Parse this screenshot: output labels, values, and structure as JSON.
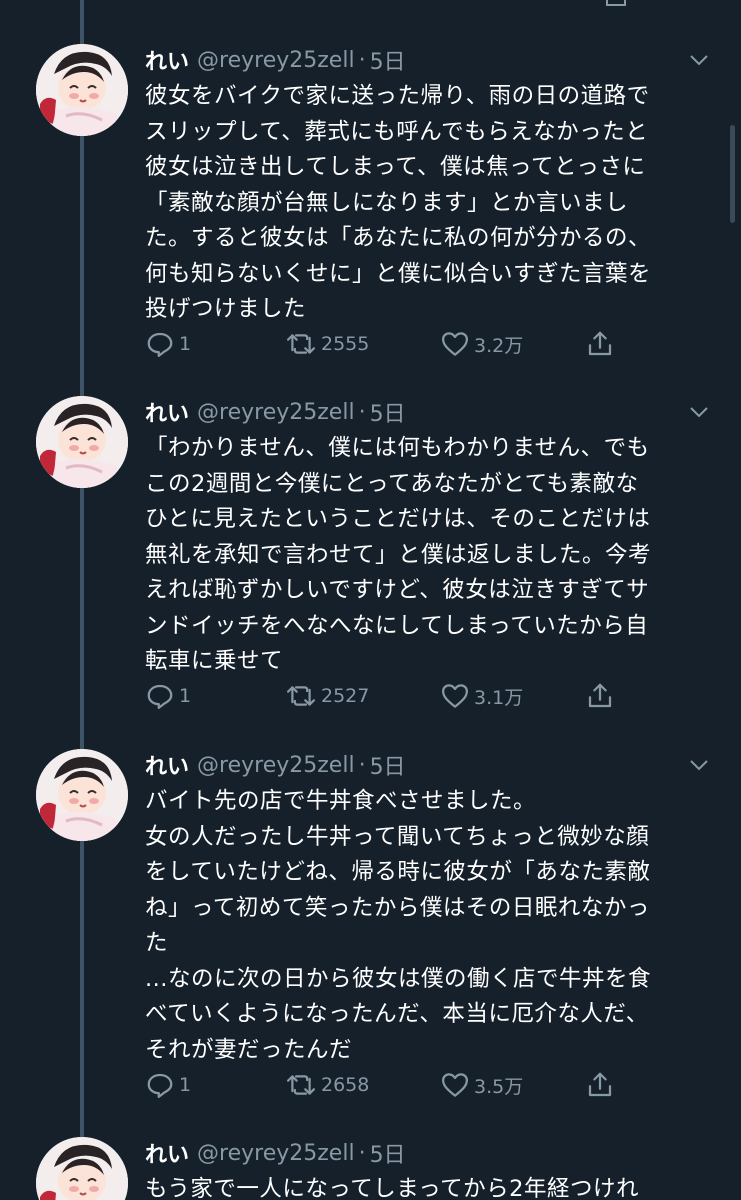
{
  "colors": {
    "background": "#15202b",
    "secondary_text": "#8899a6",
    "thread_line": "#3d5466"
  },
  "tweets": [
    {
      "name": "れい",
      "handle": "@reyrey25zell",
      "dot": "·",
      "age": "5日",
      "lines": [
        "彼女をバイクで家に送った帰り、雨の日の道路で",
        "スリップして、葬式にも呼んでもらえなかったと",
        "彼女は泣き出してしまって、僕は焦ってとっさに",
        "「素敵な顔が台無しになります」とか言いまし",
        "た。すると彼女は「あなたに私の何が分かるの、",
        "何も知らないくせに」と僕に似合いすぎた言葉を",
        "投げつけました"
      ],
      "replies": "1",
      "retweets": "2555",
      "likes": "3.2万"
    },
    {
      "name": "れい",
      "handle": "@reyrey25zell",
      "dot": "·",
      "age": "5日",
      "lines": [
        "「わかりません、僕には何もわかりません、でも",
        "この2週間と今僕にとってあなたがとても素敵な",
        "ひとに見えたということだけは、そのことだけは",
        "無礼を承知で言わせて」と僕は返しました。今考",
        "えれば恥ずかしいですけど、彼女は泣きすぎてサ",
        "ンドイッチをへなへなにしてしまっていたから自",
        "転車に乗せて"
      ],
      "replies": "1",
      "retweets": "2527",
      "likes": "3.1万"
    },
    {
      "name": "れい",
      "handle": "@reyrey25zell",
      "dot": "·",
      "age": "5日",
      "lines": [
        "バイト先の店で牛丼食べさせました。",
        "女の人だったし牛丼って聞いてちょっと微妙な顔",
        "をしていたけどね、帰る時に彼女が「あなた素敵",
        "ね」って初めて笑ったから僕はその日眠れなかっ",
        "た",
        "...なのに次の日から彼女は僕の働く店で牛丼を食",
        "べていくようになったんだ、本当に厄介な人だ、",
        "それが妻だったんだ"
      ],
      "replies": "1",
      "retweets": "2658",
      "likes": "3.5万"
    },
    {
      "name": "れい",
      "handle": "@reyrey25zell",
      "dot": "·",
      "age": "5日",
      "lines": [
        "もう家で一人になってしまってから2年経つけれ"
      ]
    }
  ]
}
